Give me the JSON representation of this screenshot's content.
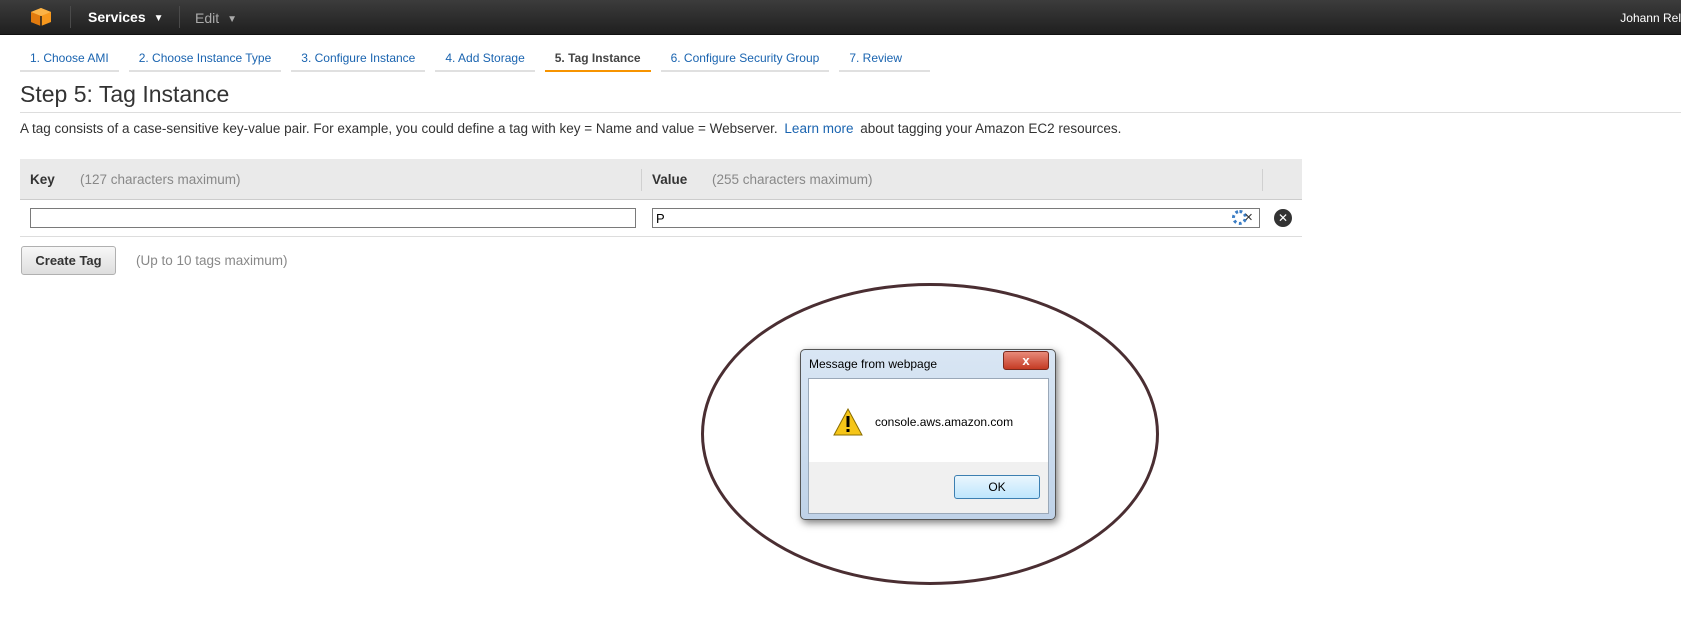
{
  "topbar": {
    "logo_icon": "aws-cube-icon",
    "services_label": "Services",
    "edit_label": "Edit",
    "user_label": "Johann Rel"
  },
  "wizard": {
    "tabs": [
      {
        "label": "1. Choose AMI",
        "active": false
      },
      {
        "label": "2. Choose Instance Type",
        "active": false
      },
      {
        "label": "3. Configure Instance",
        "active": false
      },
      {
        "label": "4. Add Storage",
        "active": false
      },
      {
        "label": "5. Tag Instance",
        "active": true
      },
      {
        "label": "6. Configure Security Group",
        "active": false
      },
      {
        "label": "7. Review",
        "active": false
      }
    ]
  },
  "page": {
    "title": "Step 5: Tag Instance",
    "desc_before": "A tag consists of a case-sensitive key-value pair. For example, you could define a tag with key = Name and value = Webserver.",
    "learn_more": "Learn more",
    "desc_after": "about tagging your Amazon EC2 resources."
  },
  "table": {
    "key_header": "Key",
    "key_hint": "(127 characters maximum)",
    "value_header": "Value",
    "value_hint": "(255 characters maximum)",
    "row": {
      "key_value": "",
      "value_value": "P"
    }
  },
  "actions": {
    "create_tag": "Create Tag",
    "create_hint": "(Up to 10 tags maximum)"
  },
  "dialog": {
    "title": "Message from webpage",
    "close_label": "x",
    "message": "console.aws.amazon.com",
    "ok_label": "OK",
    "icon": "warning-icon"
  },
  "colors": {
    "accent": "#f79400",
    "link": "#1a64b0",
    "highlight_ring": "#4a2e32"
  }
}
